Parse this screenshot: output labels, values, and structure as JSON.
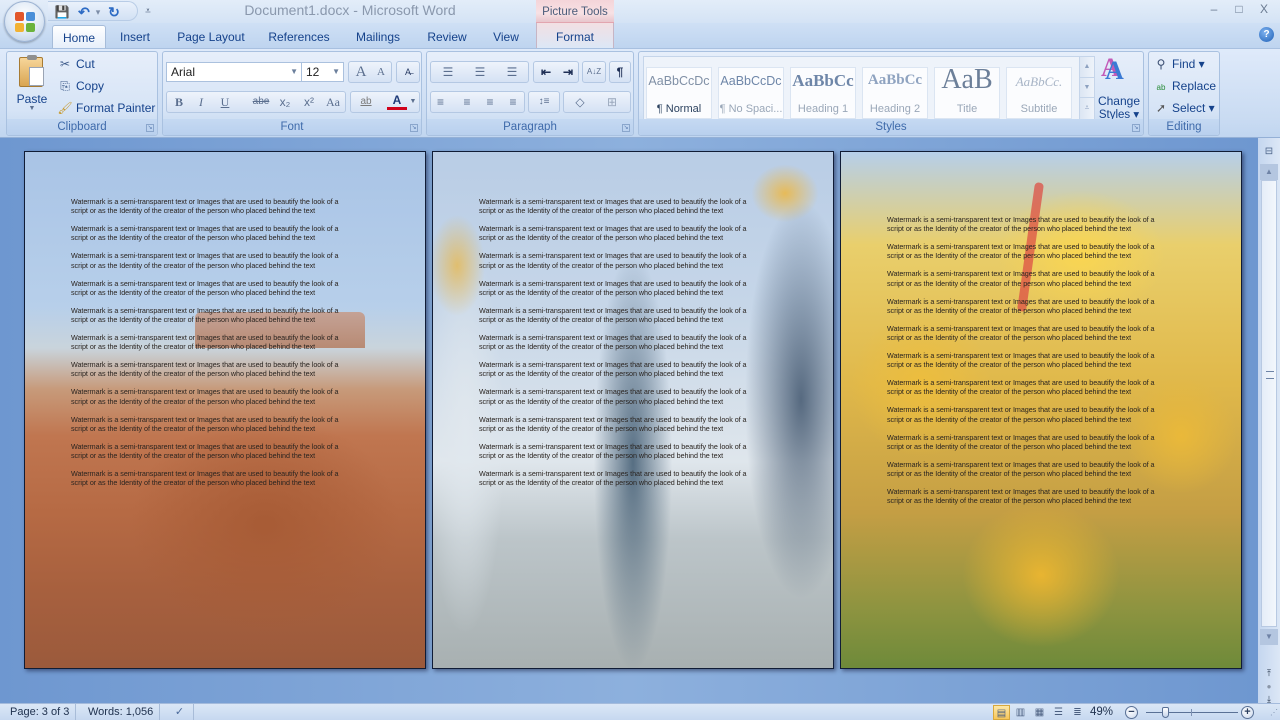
{
  "window": {
    "title": "Document1.docx - Microsoft Word",
    "contextual_tab_group": "Picture Tools",
    "controls": {
      "minimize": "–",
      "maximize": "□",
      "close": "X"
    }
  },
  "quick_access": [
    {
      "name": "save",
      "icon": "💾"
    },
    {
      "name": "undo",
      "icon": "↶"
    },
    {
      "name": "undo-dropdown",
      "icon": "▾"
    },
    {
      "name": "redo",
      "icon": "↻"
    },
    {
      "name": "customize",
      "icon": "⩡"
    }
  ],
  "tabs": [
    {
      "label": "Home",
      "active": true
    },
    {
      "label": "Insert"
    },
    {
      "label": "Page Layout"
    },
    {
      "label": "References"
    },
    {
      "label": "Mailings"
    },
    {
      "label": "Review"
    },
    {
      "label": "View"
    },
    {
      "label": "Format",
      "contextual": true
    }
  ],
  "help_icon": "?",
  "ribbon": {
    "clipboard": {
      "label": "Clipboard",
      "paste": "Paste",
      "cut": "Cut",
      "copy": "Copy",
      "format_painter": "Format Painter"
    },
    "font": {
      "label": "Font",
      "font_name": "Arial",
      "font_size": "12",
      "grow": "A",
      "shrink": "A",
      "clear": "A̶",
      "bold": "B",
      "italic": "I",
      "underline": "U",
      "strikethrough": "abe",
      "subscript": "x₂",
      "superscript": "x²",
      "change_case": "Aa",
      "highlight": "ab",
      "font_color": "A",
      "font_color_value": "#d0021b"
    },
    "paragraph": {
      "label": "Paragraph",
      "bullets": "☰",
      "numbering": "☰",
      "multilevel": "☰",
      "decrease_indent": "⇤",
      "increase_indent": "⇥",
      "sort": "A↓Z",
      "show_marks": "¶",
      "align_left": "≡",
      "center": "≡",
      "align_right": "≡",
      "justify": "≡",
      "line_spacing": "↕≡",
      "shading": "◇",
      "borders": "⊞"
    },
    "styles": {
      "label": "Styles",
      "items": [
        {
          "sample": "AaBbCcDc",
          "name": "¶ Normal",
          "selected": true
        },
        {
          "sample": "AaBbCcDc",
          "name": "¶ No Spaci..."
        },
        {
          "sample": "AaBbCc",
          "name": "Heading 1"
        },
        {
          "sample": "AaBbCc",
          "name": "Heading 2"
        },
        {
          "sample": "AaB",
          "name": "Title"
        },
        {
          "sample": "AaBbCc.",
          "name": "Subtitle"
        }
      ],
      "change_styles_line1": "Change",
      "change_styles_line2": "Styles ▾"
    },
    "editing": {
      "label": "Editing",
      "find": "Find ▾",
      "replace": "Replace",
      "select": "Select ▾"
    }
  },
  "document": {
    "paragraph_line1": "Watermark is a semi-transparent text or Images that are used to beautify the look of a",
    "paragraph_line2": "script or as the Identity of the creator of the  person who placed behind the text",
    "pages": [
      {
        "background": "desert-monument-valley",
        "paragraph_count": 11
      },
      {
        "background": "penguins",
        "paragraph_count": 11
      },
      {
        "background": "yellow-tulips",
        "paragraph_count": 11
      }
    ]
  },
  "status": {
    "page": "Page: 3 of 3",
    "words": "Words: 1,056",
    "zoom": "49%",
    "zoom_value_percent": 49
  }
}
